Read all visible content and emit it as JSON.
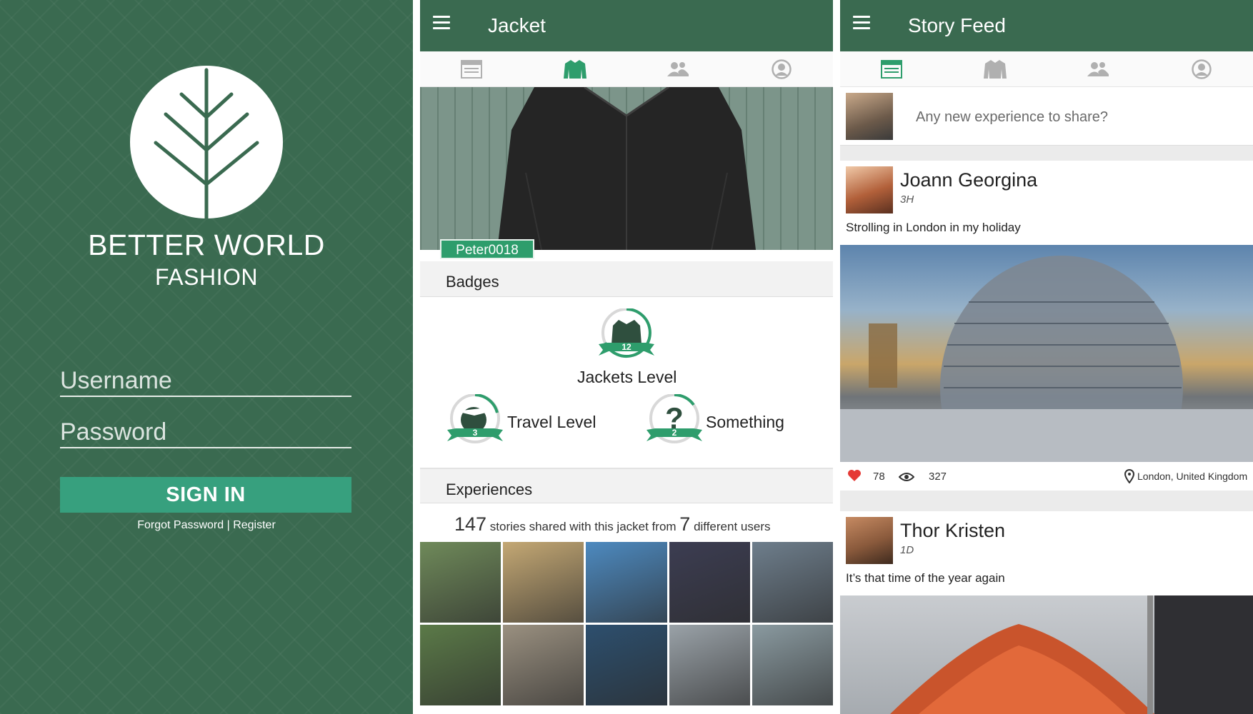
{
  "colors": {
    "brand_green": "#3a6a50",
    "accent_green": "#37a07e",
    "tab_active": "#2e9d6c",
    "heart": "#e53935"
  },
  "login": {
    "brand_name": "BETTER WORLD",
    "brand_sub": "FASHION",
    "username_placeholder": "Username",
    "password_placeholder": "Password",
    "signin_label": "SIGN IN",
    "forgot_label": "Forgot Password",
    "separator": " | ",
    "register_label": "Register"
  },
  "jacket_screen": {
    "title": "Jacket",
    "tabs": [
      "feed-icon",
      "jacket-icon",
      "people-icon",
      "profile-icon"
    ],
    "active_tab": 1,
    "owner_tag": "Peter0018",
    "badges_heading": "Badges",
    "badges": [
      {
        "label": "Jackets Level",
        "level": "12",
        "icon": "jacket-icon"
      },
      {
        "label": "Travel Level",
        "level": "3",
        "icon": "globe-plane-icon"
      },
      {
        "label": "Something",
        "level": "2",
        "icon": "question-icon"
      }
    ],
    "experiences_heading": "Experiences",
    "stories_count": "147",
    "stories_text": "stories shared with this jacket from",
    "users_count": "7",
    "users_text": "different users",
    "photo_colors": [
      "#6f8a5a",
      "#c4a874",
      "#4d8ac0",
      "#3c3d52",
      "#6e7e8c",
      "#5b7a48",
      "#9a9080",
      "#2d4f6e",
      "#9aa2a8",
      "#8a9aa0"
    ]
  },
  "feed_screen": {
    "title": "Story Feed",
    "active_tab": 0,
    "composer_placeholder": "Any new experience to share?",
    "posts": [
      {
        "name": "Joann Georgina",
        "time": "3H",
        "text": "Strolling in London in my holiday",
        "likes": "78",
        "views": "327",
        "location": "London, United Kingdom"
      },
      {
        "name": "Thor Kristen",
        "time": "1D",
        "text": "It’s that time of the year again"
      }
    ]
  }
}
